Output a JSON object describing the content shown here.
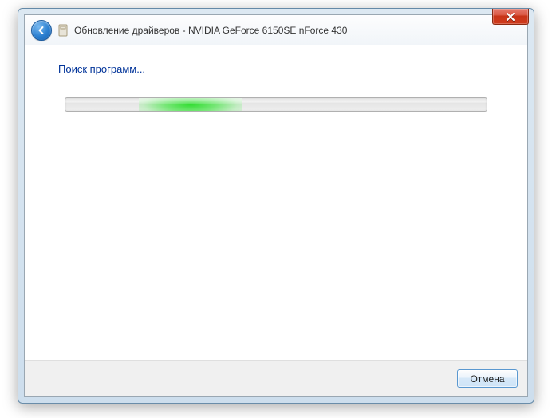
{
  "window": {
    "title": "Обновление драйверов - NVIDIA GeForce 6150SE nForce 430"
  },
  "content": {
    "heading": "Поиск программ..."
  },
  "footer": {
    "cancel_label": "Отмена"
  }
}
